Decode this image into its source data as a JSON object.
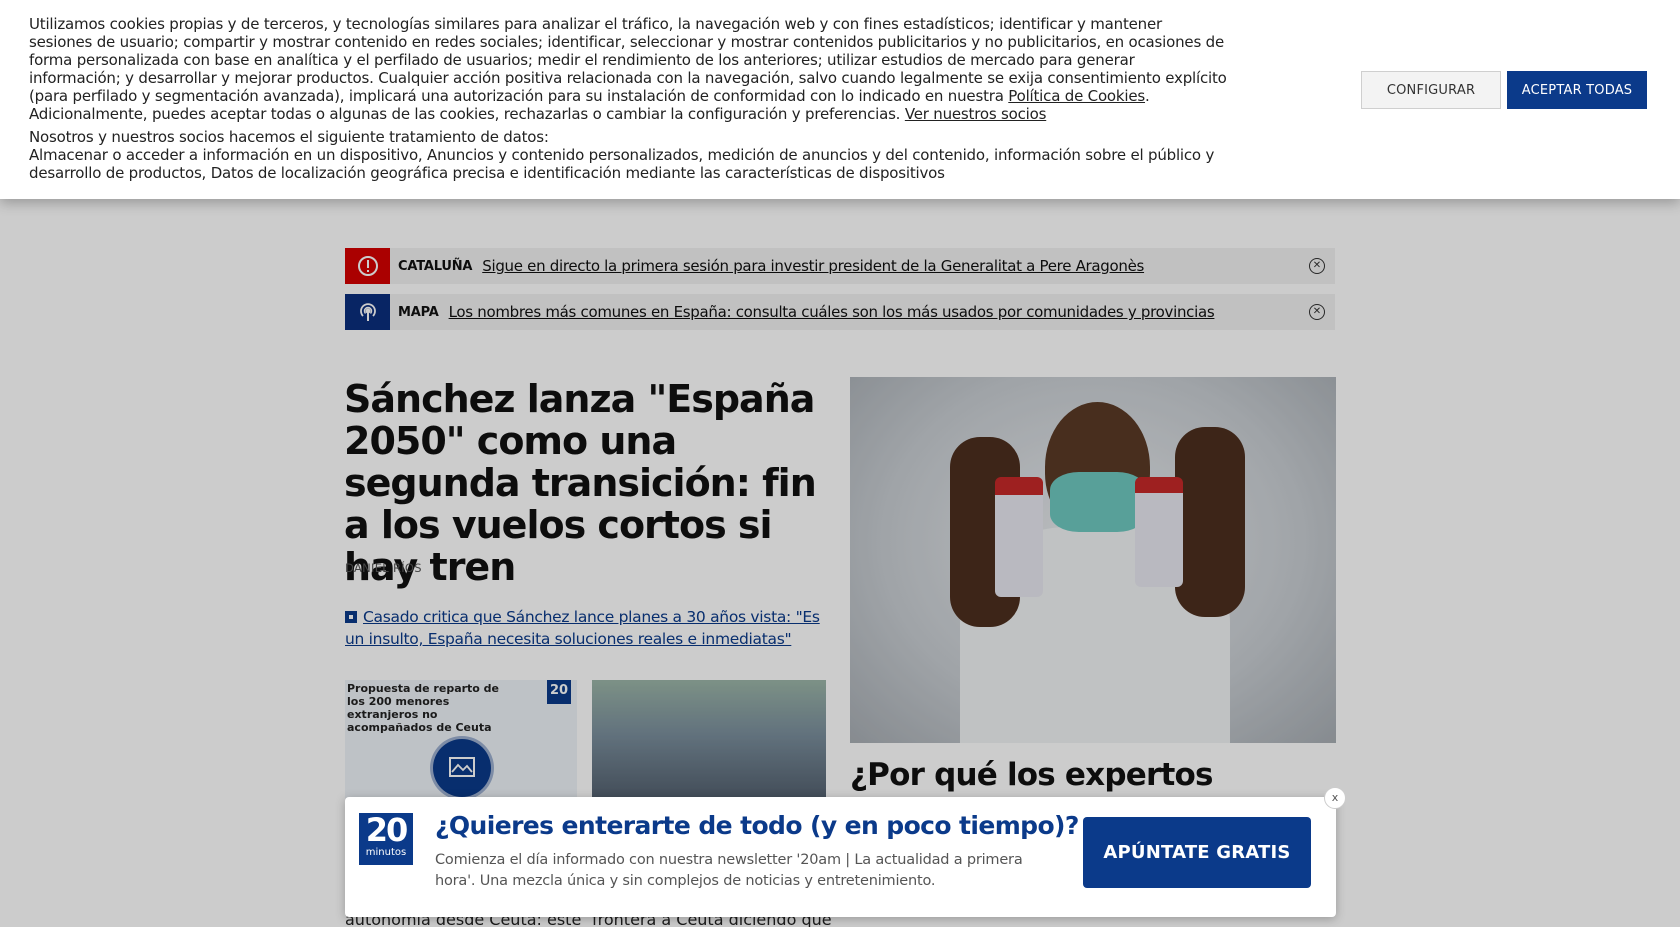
{
  "cookie_banner": {
    "text_before_link": "Utilizamos cookies propias y de terceros, y tecnologías similares para analizar el tráfico, la navegación web y con fines estadísticos; identificar y mantener sesiones de usuario; compartir y mostrar contenido en redes sociales; identificar, seleccionar y mostrar contenidos publicitarios y no publicitarios, en ocasiones de forma personalizada con base en analítica y el perfilado de usuarios; medir el rendimiento de los anteriores; utilizar estudios de mercado para generar información; y desarrollar y mejorar productos. Cualquier acción positiva relacionada con la navegación, salvo cuando legalmente se exija consentimiento explícito (para perfilado y segmentación avanzada), implicará una autorización para su instalación de conformidad con lo indicado en nuestra ",
    "policy_link": "Política de Cookies",
    "text_after_link": ". Adicionalmente, puedes aceptar todas o algunas de las cookies, rechazarlas o cambiar la configuración y preferencias. ",
    "partners_link": "Ver nuestros socios",
    "processing_intro": "Nosotros y nuestros socios hacemos el siguiente tratamiento de datos:",
    "processing_list": "Almacenar o acceder a información en un dispositivo, Anuncios y contenido personalizados, medición de anuncios y del contenido, información sobre el público y desarrollo de productos, Datos de localización geográfica precisa e identificación mediante las características de dispositivos",
    "configure_label": "CONFIGURAR",
    "accept_label": "ACEPTAR TODAS"
  },
  "alerts": [
    {
      "category": "CATALUÑA",
      "text": "Sigue en directo la primera sesión para investir president de la Generalitat a Pere Aragonès",
      "close": "✕"
    },
    {
      "category": "MAPA",
      "text": "Los nombres más comunes en España: consulta cuáles son los más usados por comunidades y provincias",
      "close": "✕"
    }
  ],
  "main_story": {
    "headline": "Sánchez lanza \"España 2050\" como una segunda transición: fin a los vuelos cortos si hay tren",
    "author": "DANIEL RÍOS",
    "related": "Casado critica que Sánchez lance planes a 30 años vista: \"Es un insulto, España necesita soluciones reales e inmediatas\""
  },
  "thumb_infographic": {
    "title": "Propuesta de reparto de los 200 menores extranjeros no acompañados de Ceuta",
    "logo": "20"
  },
  "side_story": {
    "headline": "¿Por qué los expertos apoyan la"
  },
  "bottom_texts": [
    "autonomía desde Ceuta: este",
    "frontera a Ceuta diciendo que"
  ],
  "newsletter": {
    "close": "x",
    "logo_number": "20",
    "logo_text": "minutos",
    "title": "¿Quieres enterarte de todo (y en poco tiempo)?",
    "description": "Comienza el día informado con nuestra newsletter '20am | La actualidad a primera hora'. Una mezcla única y sin complejos de noticias y entretenimiento.",
    "cta": "APÚNTATE GRATIS"
  }
}
